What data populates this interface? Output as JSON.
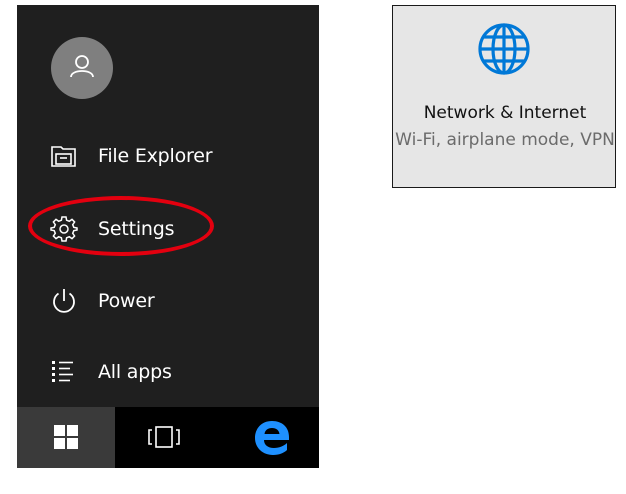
{
  "start_menu": {
    "items": [
      {
        "id": "file-explorer",
        "label": "File Explorer",
        "icon": "file-explorer-icon"
      },
      {
        "id": "settings",
        "label": "Settings",
        "icon": "gear-icon"
      },
      {
        "id": "power",
        "label": "Power",
        "icon": "power-icon"
      },
      {
        "id": "all-apps",
        "label": "All apps",
        "icon": "all-apps-list-icon"
      }
    ],
    "avatar_icon": "user-avatar-icon",
    "highlight_color": "#e3000f",
    "background_color": "#1f1f1f"
  },
  "taskbar": {
    "buttons": [
      {
        "id": "start",
        "icon": "windows-logo-icon"
      },
      {
        "id": "task-view",
        "icon": "task-view-icon"
      },
      {
        "id": "edge",
        "icon": "edge-browser-icon",
        "color": "#1e90ff"
      }
    ]
  },
  "settings_tile": {
    "title": "Network & Internet",
    "description": "Wi-Fi, airplane mode, VPN",
    "icon": "globe-icon",
    "icon_color": "#0078d7"
  }
}
